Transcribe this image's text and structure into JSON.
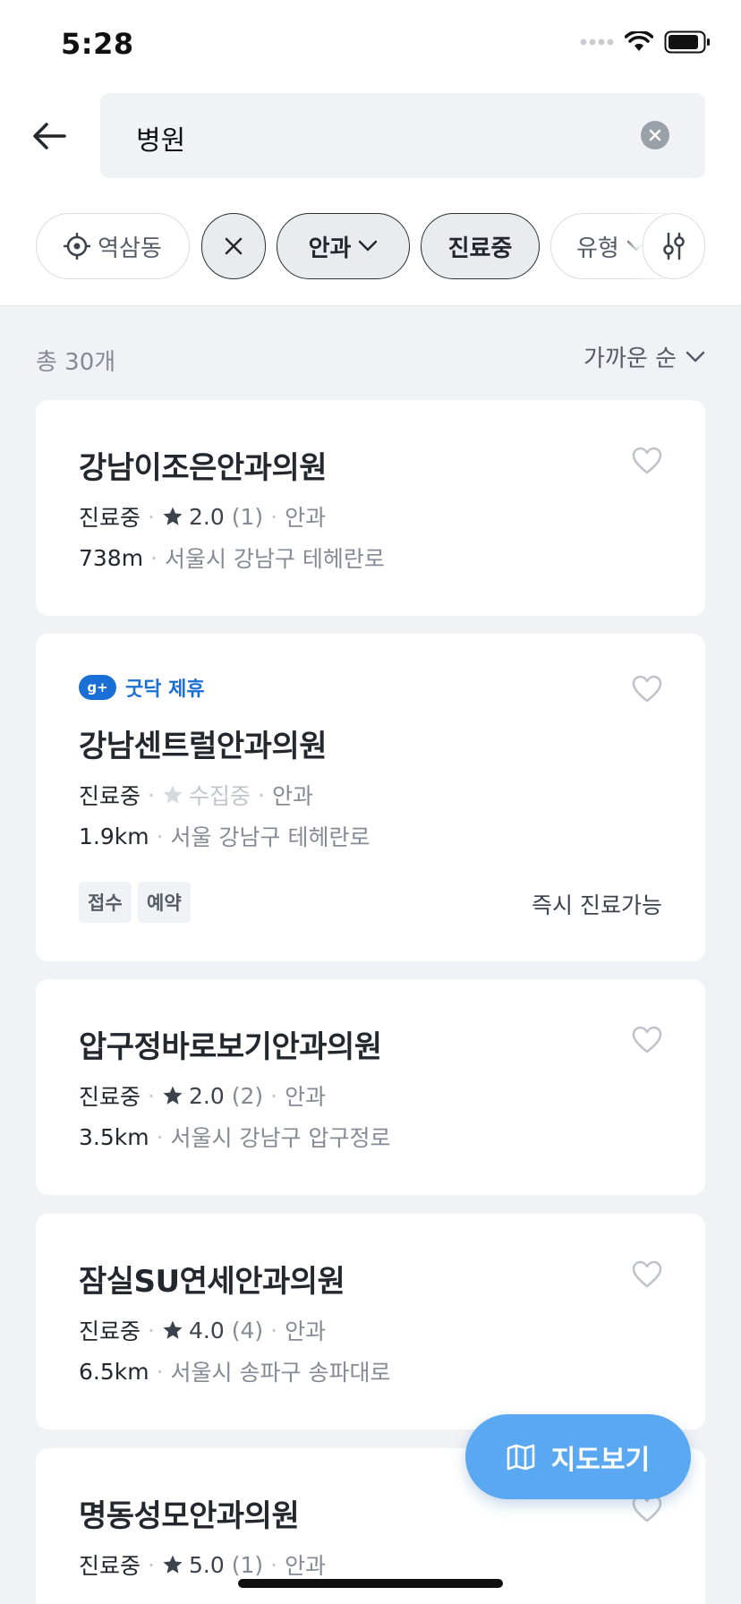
{
  "status_bar": {
    "time": "5:28"
  },
  "search": {
    "query": "병원"
  },
  "filters": {
    "location": "역삼동",
    "department": "안과",
    "open_now": "진료중",
    "type": "유형"
  },
  "list": {
    "total": "총 30개",
    "sort": "가까운 순"
  },
  "cards": [
    {
      "name": "강남이조은안과의원",
      "status": "진료중",
      "rating": "2.0",
      "count": "(1)",
      "dept": "안과",
      "distance": "738m",
      "address": "서울시 강남구 테헤란로"
    },
    {
      "partner_label": "굿닥 제휴",
      "partner_badge": "g+",
      "name": "강남센트럴안과의원",
      "status": "진료중",
      "rating_text": "수집중",
      "dept": "안과",
      "distance": "1.9km",
      "address": "서울 강남구 테헤란로",
      "tags": [
        "접수",
        "예약"
      ],
      "instant": "즉시 진료가능"
    },
    {
      "name": "압구정바로보기안과의원",
      "status": "진료중",
      "rating": "2.0",
      "count": "(2)",
      "dept": "안과",
      "distance": "3.5km",
      "address": "서울시 강남구 압구정로"
    },
    {
      "name": "잠실SU연세안과의원",
      "status": "진료중",
      "rating": "4.0",
      "count": "(4)",
      "dept": "안과",
      "distance": "6.5km",
      "address": "서울시 송파구 송파대로"
    },
    {
      "name": "명동성모안과의원",
      "status": "진료중",
      "rating": "5.0",
      "count": "(1)",
      "dept": "안과"
    }
  ],
  "map_button": {
    "label": "지도보기"
  },
  "colors": {
    "accent": "#1a6fd6",
    "map_button": "#5aa8f2",
    "background": "#f0f2f5"
  }
}
